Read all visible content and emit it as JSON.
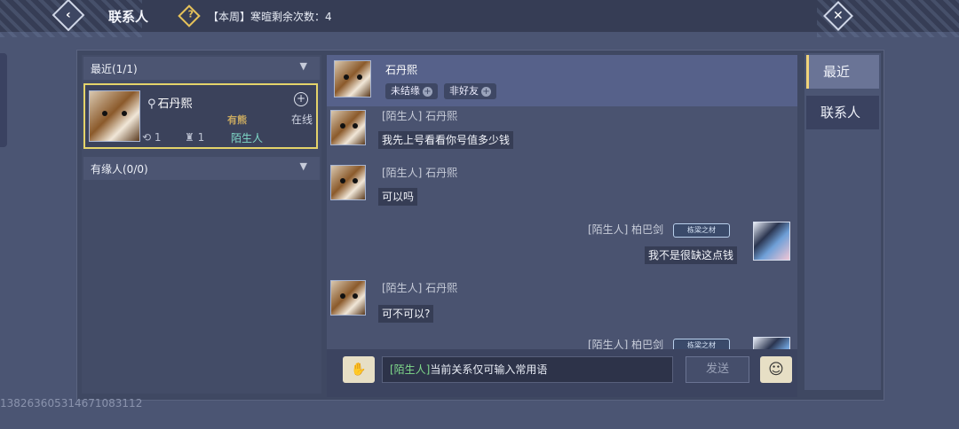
{
  "topbar": {
    "title": "联系人",
    "help_icon": "question-diamond-icon",
    "weekly_text": "【本周】寒暄剩余次数：4"
  },
  "footer": {
    "id_text": "1382636053146710831​12"
  },
  "contacts": {
    "recent_group": "最近(1/1)",
    "friends_group": "有缘人(0/0)",
    "card": {
      "name": "石丹熙",
      "status": "在线",
      "tag": "有熊",
      "stat1": "1",
      "stat2": "1",
      "relation": "陌生人"
    }
  },
  "chat": {
    "header": {
      "name": "石丹熙",
      "pill1": "未结缘",
      "pill2": "非好友"
    },
    "messages": [
      {
        "sender": "[陌生人] 石丹熙",
        "text": "我先上号看看你号值多少钱"
      },
      {
        "sender": "[陌生人] 石丹熙",
        "text": "可以吗"
      },
      {
        "sender": "[陌生人] 柏巴剑",
        "text": "我不是很缺这点钱",
        "badge": "栋梁之材"
      },
      {
        "sender": "[陌生人] 石丹熙",
        "text": "可不可以?"
      },
      {
        "sender": "[陌生人] 柏巴剑",
        "badge": "栋梁之材"
      }
    ],
    "input": {
      "prefix": "[陌生人]",
      "placeholder": "当前关系仅可输入常用语"
    },
    "send_label": "发送"
  },
  "tabs": {
    "recent": "最近",
    "contacts": "联系人"
  }
}
